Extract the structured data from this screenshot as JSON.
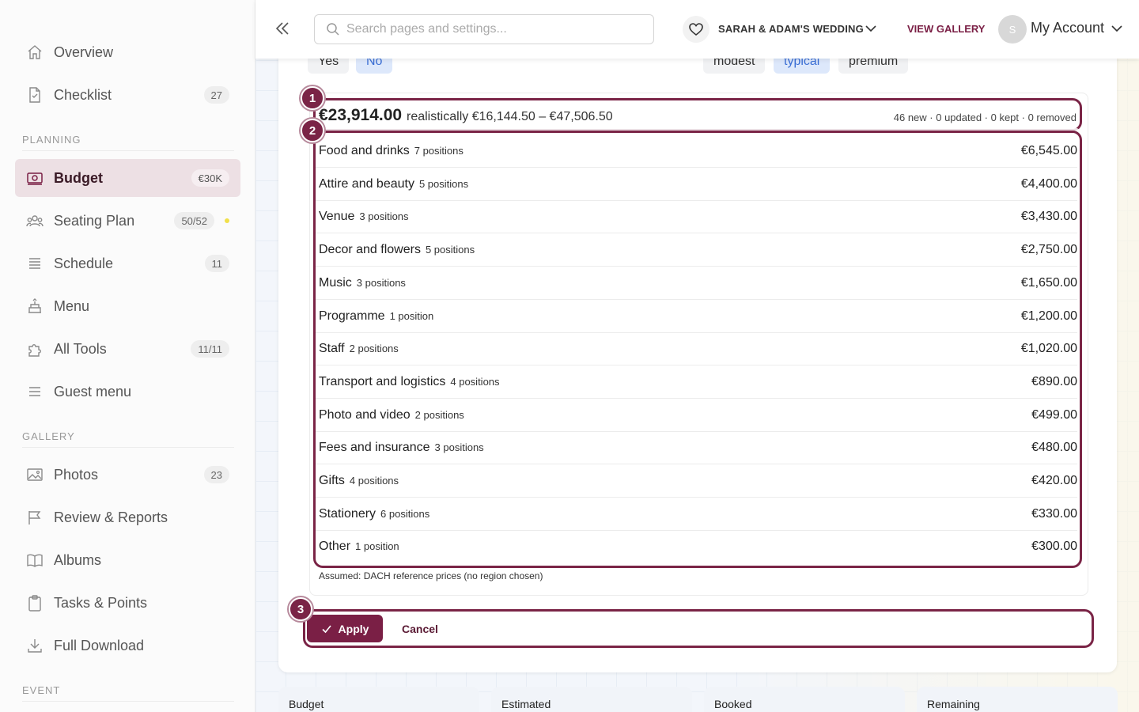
{
  "sidebar": {
    "items": [
      {
        "label": "Overview",
        "icon": "home-icon",
        "count": ""
      },
      {
        "label": "Checklist",
        "icon": "checklist-icon",
        "count": "27"
      }
    ],
    "planning_title": "PLANNING",
    "planning": [
      {
        "label": "Budget",
        "icon": "budget-icon",
        "count": "€30K",
        "active": true
      },
      {
        "label": "Seating Plan",
        "icon": "seating-icon",
        "count": "50/52",
        "dot_color": "#f1e04a"
      },
      {
        "label": "Schedule",
        "icon": "schedule-icon",
        "count": "11"
      },
      {
        "label": "Menu",
        "icon": "menu-cake-icon",
        "count": ""
      },
      {
        "label": "All Tools",
        "icon": "puzzle-icon",
        "count": "11/11"
      },
      {
        "label": "Guest menu",
        "icon": "list-icon",
        "count": ""
      }
    ],
    "gallery_title": "GALLERY",
    "gallery": [
      {
        "label": "Photos",
        "icon": "photo-icon",
        "count": "23"
      },
      {
        "label": "Review & Reports",
        "icon": "flag-icon",
        "count": ""
      },
      {
        "label": "Albums",
        "icon": "book-icon",
        "count": ""
      },
      {
        "label": "Tasks & Points",
        "icon": "clipboard-icon",
        "count": ""
      },
      {
        "label": "Full Download",
        "icon": "download-icon",
        "count": ""
      }
    ],
    "event_title": "EVENT"
  },
  "topbar": {
    "search_placeholder": "Search pages and settings...",
    "event_name": "SARAH & ADAM'S WEDDING",
    "view_gallery": "VIEW GALLERY",
    "avatar_initial": "S",
    "account": "My Account"
  },
  "options": {
    "yes": "Yes",
    "no": "No",
    "modest": "modest",
    "typical": "typical",
    "premium": "premium",
    "selected_yes_no": "No",
    "selected_tier": "typical"
  },
  "estimate": {
    "total": "€23,914.00",
    "realistic": "realistically €16,144.50 – €47,506.50",
    "changes": "46 new · 0 updated · 0 kept · 0 removed",
    "categories": [
      {
        "name": "Food and drinks",
        "positions": "7 positions",
        "amount": "€6,545.00"
      },
      {
        "name": "Attire and beauty",
        "positions": "5 positions",
        "amount": "€4,400.00"
      },
      {
        "name": "Venue",
        "positions": "3 positions",
        "amount": "€3,430.00"
      },
      {
        "name": "Decor and flowers",
        "positions": "5 positions",
        "amount": "€2,750.00"
      },
      {
        "name": "Music",
        "positions": "3 positions",
        "amount": "€1,650.00"
      },
      {
        "name": "Programme",
        "positions": "1 position",
        "amount": "€1,200.00"
      },
      {
        "name": "Staff",
        "positions": "2 positions",
        "amount": "€1,020.00"
      },
      {
        "name": "Transport and logistics",
        "positions": "4 positions",
        "amount": "€890.00"
      },
      {
        "name": "Photo and video",
        "positions": "2 positions",
        "amount": "€499.00"
      },
      {
        "name": "Fees and insurance",
        "positions": "3 positions",
        "amount": "€480.00"
      },
      {
        "name": "Gifts",
        "positions": "4 positions",
        "amount": "€420.00"
      },
      {
        "name": "Stationery",
        "positions": "6 positions",
        "amount": "€330.00"
      },
      {
        "name": "Other",
        "positions": "1 position",
        "amount": "€300.00"
      }
    ],
    "assumed": "Assumed: DACH reference prices (no region chosen)"
  },
  "actions": {
    "apply": "Apply",
    "cancel": "Cancel"
  },
  "badges": [
    "1",
    "2",
    "3"
  ],
  "stats": [
    "Budget",
    "Estimated",
    "Booked",
    "Remaining"
  ],
  "colors": {
    "accent": "#7a1f45",
    "highlight": "#7a2446",
    "selected_pill": "#dde8fb"
  }
}
